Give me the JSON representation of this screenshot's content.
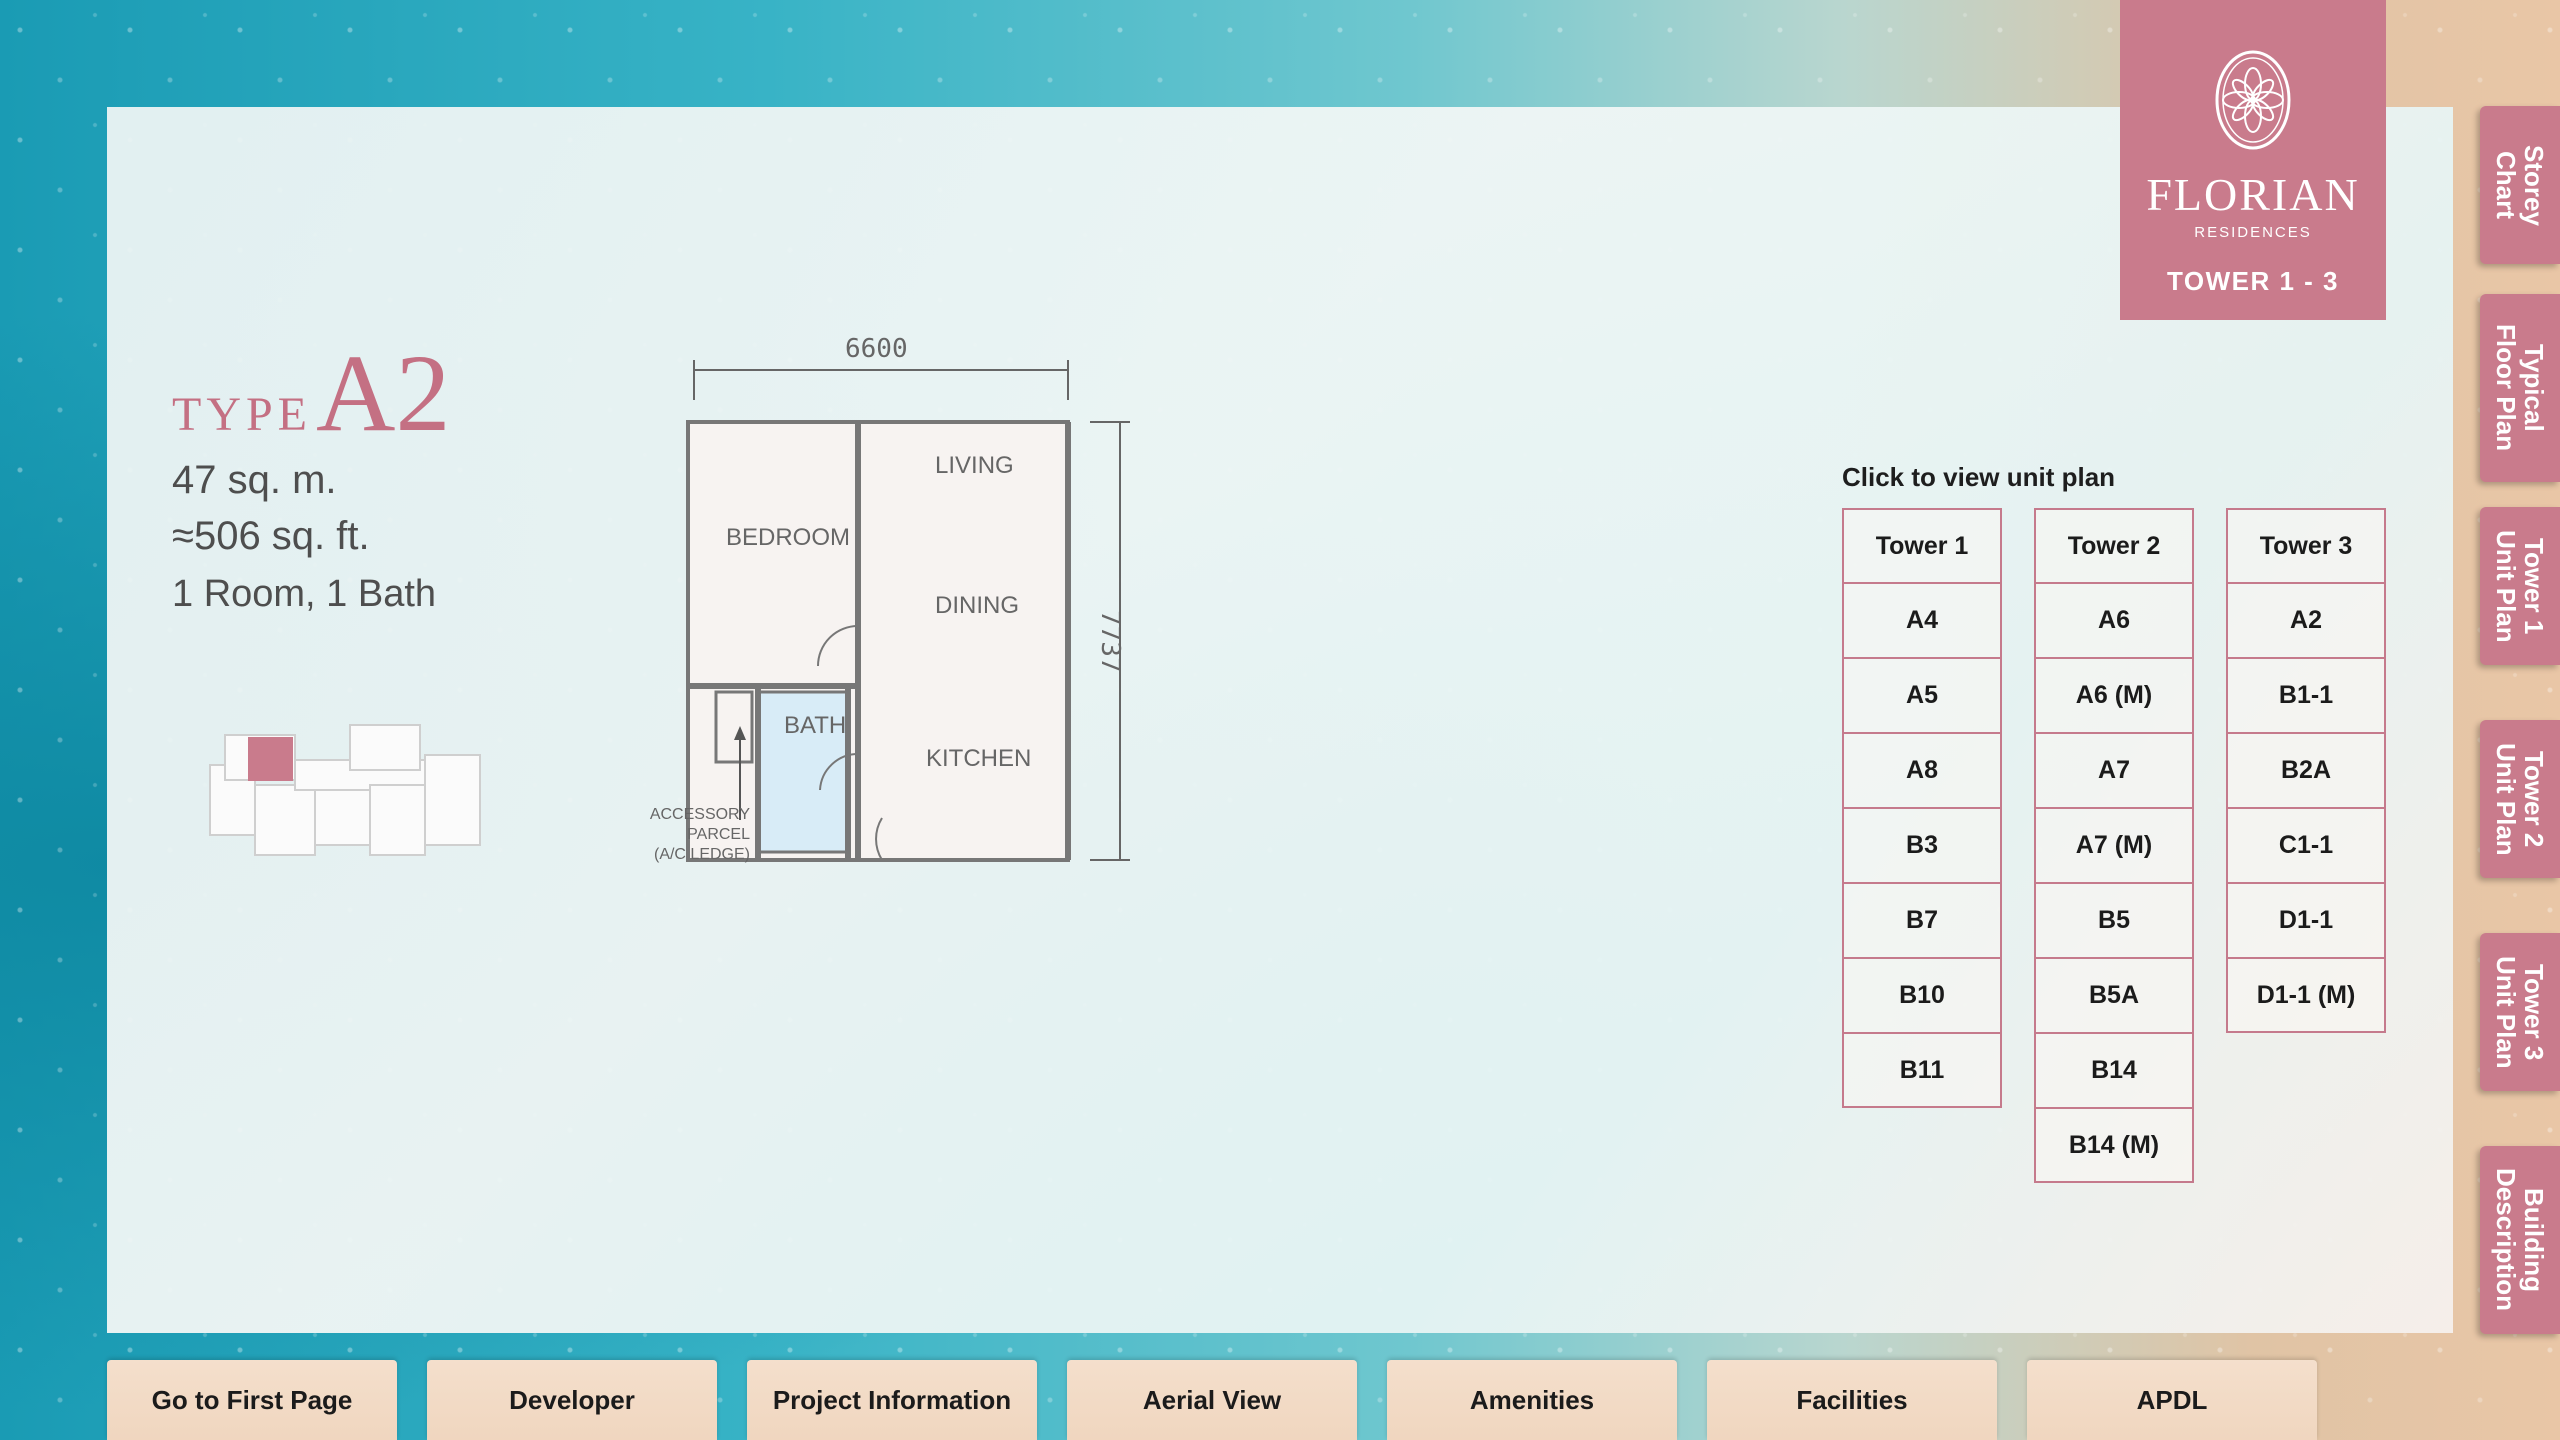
{
  "brand": {
    "name": "FLORIAN",
    "sub": "RESIDENCES",
    "tower_range": "TOWER 1 - 3"
  },
  "unit": {
    "type_word": "TYPE",
    "type_code": "A2",
    "area_sqm": "47 sq. m.",
    "area_sqft": "≈506 sq. ft.",
    "rooms": "1 Room, 1 Bath"
  },
  "floorplan": {
    "width_dim": "6600",
    "height_dim": "7737",
    "labels": {
      "living": "LIVING",
      "dining": "DINING",
      "kitchen": "KITCHEN",
      "bedroom": "BEDROOM",
      "bath": "BATH",
      "accessory_1": "ACCESSORY",
      "accessory_2": "PARCEL",
      "accessory_3": "(A/C LEDGE)"
    }
  },
  "unit_plans": {
    "heading": "Click to view unit plan",
    "towers": [
      {
        "name": "Tower 1",
        "units": [
          "A4",
          "A5",
          "A8",
          "B3",
          "B7",
          "B10",
          "B11"
        ]
      },
      {
        "name": "Tower 2",
        "units": [
          "A6",
          "A6 (M)",
          "A7",
          "A7 (M)",
          "B5",
          "B5A",
          "B14",
          "B14 (M)"
        ]
      },
      {
        "name": "Tower 3",
        "units": [
          "A2",
          "B1-1",
          "B2A",
          "C1-1",
          "D1-1",
          "D1-1 (M)"
        ]
      }
    ]
  },
  "side_tabs": [
    "Storey\nChart",
    "Typical\nFloor Plan",
    "Tower 1\nUnit Plan",
    "Tower 2\nUnit Plan",
    "Tower 3\nUnit Plan",
    "Building\nDescription"
  ],
  "bottom_nav": [
    "Go to First Page",
    "Developer",
    "Project Information",
    "Aerial View",
    "Amenities",
    "Facilities",
    "APDL"
  ],
  "colors": {
    "accent": "#c97b8c",
    "tab_bg": "#f2dac6",
    "bath_fill": "#d8ecf7"
  }
}
